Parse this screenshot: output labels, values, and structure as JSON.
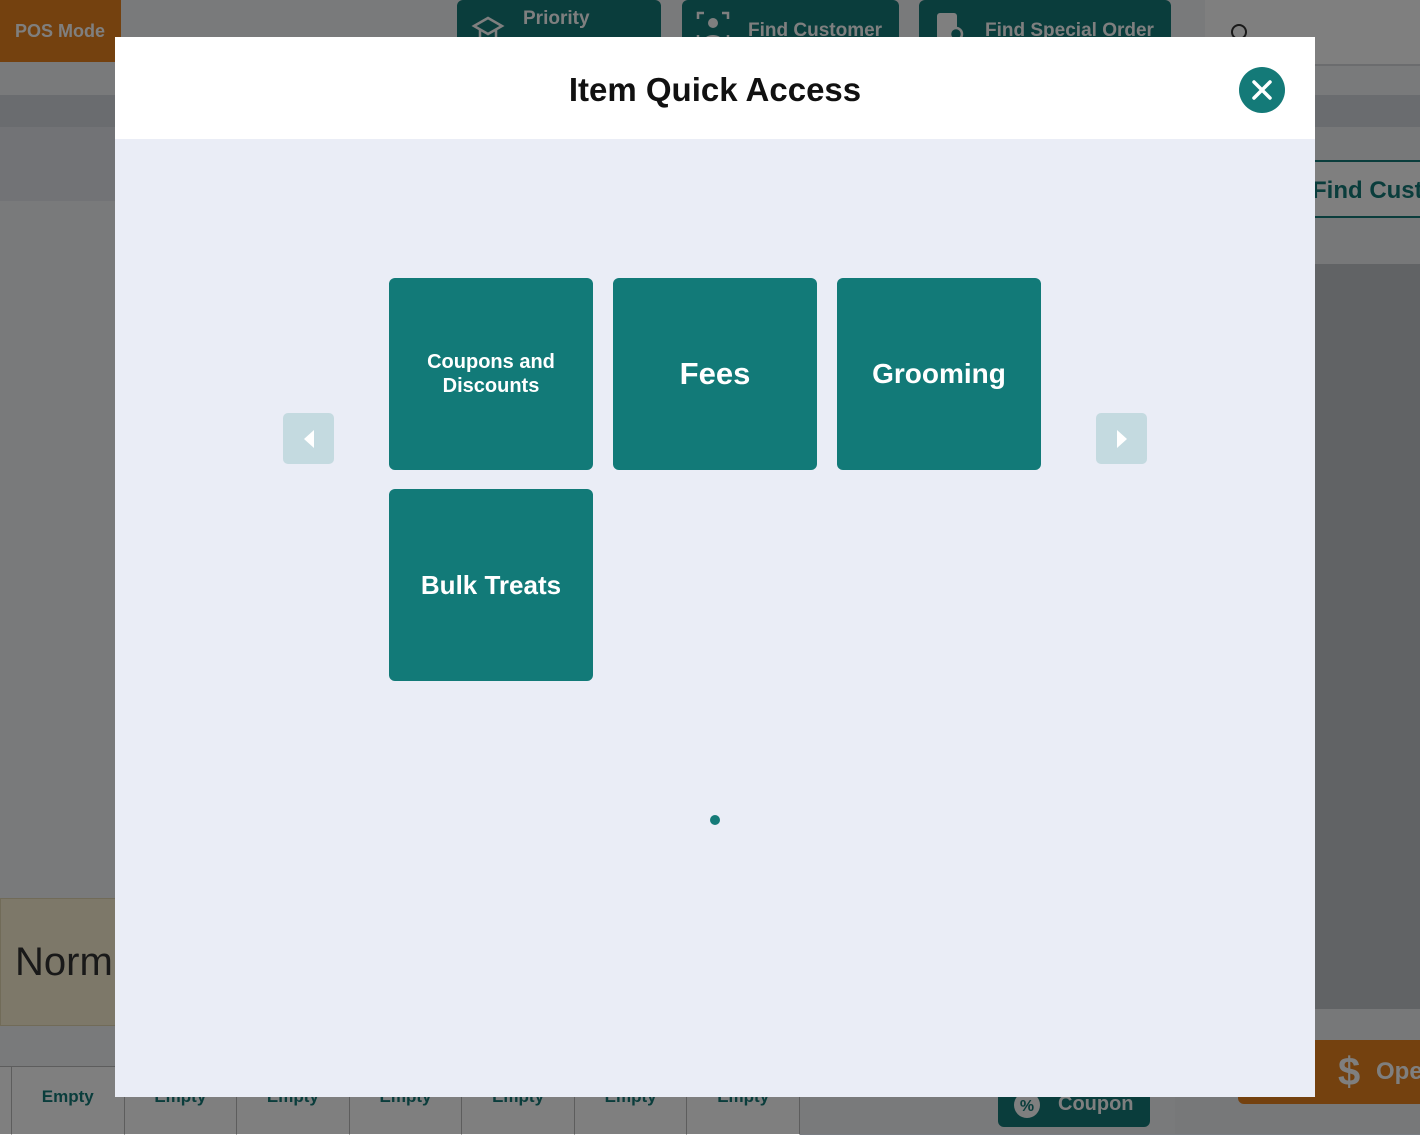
{
  "background": {
    "pos_mode": "POS Mode",
    "top_buttons": [
      "Priority",
      "Find Customer",
      "Find Special Order"
    ],
    "find_customer_side": "Find Custo",
    "normal_label": "Norm",
    "grid_cells": [
      "",
      "Empty",
      "Empty",
      "Empty",
      "Empty",
      "Empty",
      "Empty",
      "Empty"
    ],
    "coupon_label": "Coupon",
    "open_label": "Ope"
  },
  "modal": {
    "title": "Item Quick Access",
    "tiles": [
      {
        "label": "Coupons and Discounts"
      },
      {
        "label": "Fees"
      },
      {
        "label": "Grooming"
      },
      {
        "label": "Bulk Treats"
      }
    ],
    "page_count": 1,
    "current_page": 1
  },
  "colors": {
    "accent": "#127a78",
    "orange": "#e8821e",
    "modal_body": "#eaedf6",
    "arrow_disabled": "#c4dae0"
  },
  "icons": {
    "close": "close-icon",
    "prev": "chevron-left-icon",
    "next": "chevron-right-icon"
  }
}
